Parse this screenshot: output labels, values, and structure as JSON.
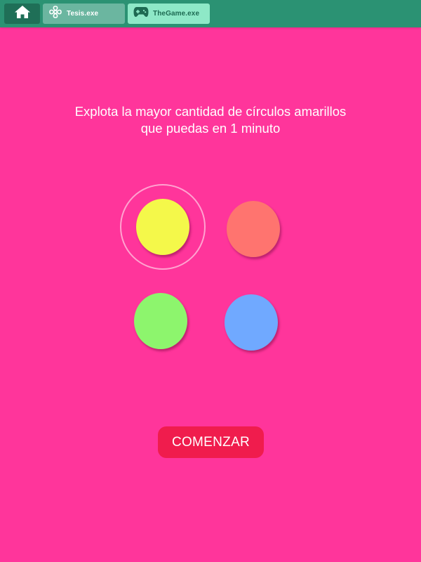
{
  "taskbar": {
    "home": {
      "icon": "home-icon",
      "color": "#1f6f57"
    },
    "tabs": [
      {
        "label": "Tesis.exe",
        "icon": "tesis-app-icon",
        "active": false,
        "color": "#6bb6a0"
      },
      {
        "label": "TheGame.exe",
        "icon": "gamepad-icon",
        "active": true,
        "color": "#8ee8c7"
      }
    ],
    "background": "#2b9273"
  },
  "game": {
    "background": "#ff359b",
    "instructions": "Explota la mayor cantidad de círculos amarillos que puedas en 1 minuto",
    "circles": [
      {
        "color_name": "yellow",
        "color": "#f4f84a",
        "highlighted": true
      },
      {
        "color_name": "coral",
        "color": "#ff746f",
        "highlighted": false
      },
      {
        "color_name": "green",
        "color": "#8df56d",
        "highlighted": false
      },
      {
        "color_name": "blue",
        "color": "#70a9ff",
        "highlighted": false
      }
    ],
    "start_label": "COMENZAR",
    "start_color": "#f01c4d"
  }
}
